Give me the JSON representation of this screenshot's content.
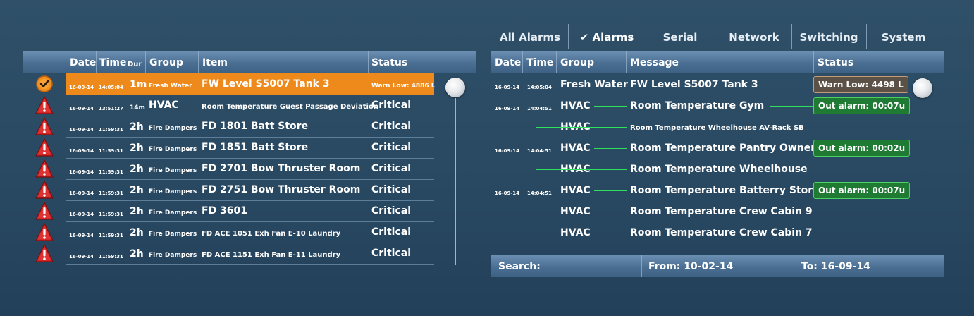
{
  "tabs": [
    {
      "label": "All Alarms",
      "active": false
    },
    {
      "label": "✔ Alarms",
      "active": true
    },
    {
      "label": "Serial",
      "active": false
    },
    {
      "label": "Network",
      "active": false
    },
    {
      "label": "Switching",
      "active": false
    },
    {
      "label": "System",
      "active": false
    }
  ],
  "left": {
    "columns": {
      "date": "Date",
      "time": "Time",
      "dur": "Dur",
      "group": "Group",
      "item": "Item",
      "status": "Status"
    },
    "rows": [
      {
        "icon": "check-icon",
        "date": "16-09-14",
        "time": "14:05:04",
        "dur": "1m",
        "group": "Fresh Water",
        "item": "FW Level S5007 Tank 3",
        "status": "Warn Low: 4886 L",
        "selected": true
      },
      {
        "icon": "warning-icon",
        "date": "16-09-14",
        "time": "13:51:27",
        "dur": "14m",
        "group": "HVAC",
        "item": "Room Temperature Guest Passage Deviation",
        "status": "Critical"
      },
      {
        "icon": "warning-icon",
        "date": "16-09-14",
        "time": "11:59:31",
        "dur": "2h",
        "group": "Fire Dampers",
        "item": "FD 1801 Batt Store",
        "status": "Critical"
      },
      {
        "icon": "warning-icon",
        "date": "16-09-14",
        "time": "11:59:31",
        "dur": "2h",
        "group": "Fire Dampers",
        "item": "FD 1851 Batt Store",
        "status": "Critical"
      },
      {
        "icon": "warning-icon",
        "date": "16-09-14",
        "time": "11:59:31",
        "dur": "2h",
        "group": "Fire Dampers",
        "item": "FD 2701 Bow Thruster Room",
        "status": "Critical"
      },
      {
        "icon": "warning-icon",
        "date": "16-09-14",
        "time": "11:59:31",
        "dur": "2h",
        "group": "Fire Dampers",
        "item": "FD 2751 Bow Thruster Room",
        "status": "Critical"
      },
      {
        "icon": "warning-icon",
        "date": "16-09-14",
        "time": "11:59:31",
        "dur": "2h",
        "group": "Fire Dampers",
        "item": "FD 3601",
        "status": "Critical"
      },
      {
        "icon": "warning-icon",
        "date": "16-09-14",
        "time": "11:59:31",
        "dur": "2h",
        "group": "Fire Dampers",
        "item": "FD ACE 1051 Exh Fan E-10 Laundry",
        "status": "Critical"
      },
      {
        "icon": "warning-icon",
        "date": "16-09-14",
        "time": "11:59:31",
        "dur": "2h",
        "group": "Fire Dampers",
        "item": "FD ACE 1151 Exh Fan E-11 Laundry",
        "status": "Critical"
      }
    ]
  },
  "right": {
    "columns": {
      "date": "Date",
      "time": "Time",
      "group": "Group",
      "message": "Message",
      "status": "Status"
    },
    "rows": [
      {
        "date": "16-09-14",
        "time": "14:05:04",
        "group": "Fresh Water",
        "message": "FW Level S5007 Tank 3",
        "status": "Warn Low: 4498 L",
        "status_kind": "warn"
      },
      {
        "date": "16-09-14",
        "time": "14:04:51",
        "group": "HVAC",
        "message": "Room Temperature Gym",
        "status": "Out alarm: 00:07u",
        "status_kind": "ok"
      },
      {
        "date": "",
        "time": "",
        "group": "HVAC",
        "message": "Room Temperature Wheelhouse AV-Rack SB",
        "status": "",
        "status_kind": "none"
      },
      {
        "date": "16-09-14",
        "time": "14:04:51",
        "group": "HVAC",
        "message": "Room Temperature Pantry Owner's Deck",
        "status": "Out alarm: 00:02u",
        "status_kind": "ok"
      },
      {
        "date": "",
        "time": "",
        "group": "HVAC",
        "message": "Room Temperature Wheelhouse",
        "status": "",
        "status_kind": "none"
      },
      {
        "date": "16-09-14",
        "time": "14:04:51",
        "group": "HVAC",
        "message": "Room Temperature Batterry Store",
        "status": "Out alarm: 00:07u",
        "status_kind": "ok"
      },
      {
        "date": "",
        "time": "",
        "group": "HVAC",
        "message": "Room Temperature Crew Cabin 9",
        "status": "",
        "status_kind": "none"
      },
      {
        "date": "",
        "time": "",
        "group": "HVAC",
        "message": "Room Temperature Crew Cabin 7",
        "status": "",
        "status_kind": "none"
      }
    ]
  },
  "search": {
    "label": "Search:",
    "from": "From: 10-02-14",
    "to": "To: 16-09-14"
  },
  "colors": {
    "selected": "#ee8a1c",
    "ok": "#2fe05a",
    "critical": "#cc1f1f",
    "warn_line": "#c58c60"
  }
}
